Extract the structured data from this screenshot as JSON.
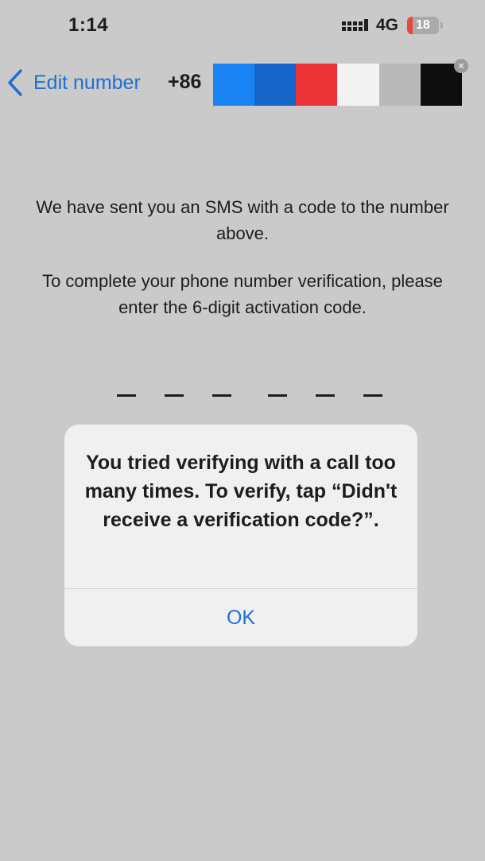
{
  "status_bar": {
    "time": "1:14",
    "signal_icon": "cellular-signal-icon",
    "network": "4G",
    "battery_level": "18",
    "battery_fraction": 0.18,
    "battery_color": "#e5483e"
  },
  "nav": {
    "back_icon": "chevron-left-icon",
    "back_label": "Edit number",
    "country_code": "+86",
    "phone_number_redaction_colors": [
      "#1a84f4",
      "#1565c8",
      "#ec3439",
      "#f3f3f3",
      "#b9b9b9",
      "#0e0e0e"
    ],
    "clear_icon": "clear-x-icon",
    "clear_glyph": "×"
  },
  "instructions": {
    "line1": "We have sent you an SMS with a code to the number above.",
    "line2": "To complete your phone number verification, please enter the 6-digit activation code."
  },
  "code_entry": {
    "digits": 6
  },
  "alert": {
    "message": "You tried verifying with a call too many times. To verify, tap “Didn't receive a verification code?”.",
    "ok_label": "OK"
  },
  "colors": {
    "accent": "#1f6fd6",
    "background": "#c9cac9"
  }
}
